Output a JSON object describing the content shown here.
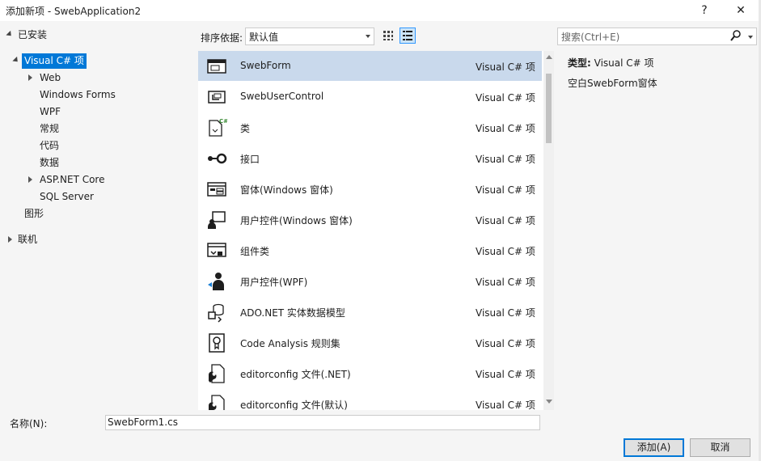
{
  "window": {
    "title": "添加新项 - SwebApplication2",
    "help_label": "?",
    "close_label": "✕"
  },
  "tree": {
    "installed": "已安装",
    "visual_cs": "Visual C# 项",
    "web": "Web",
    "winforms": "Windows Forms",
    "wpf": "WPF",
    "normal": "常规",
    "code": "代码",
    "data": "数据",
    "aspnet": "ASP.NET Core",
    "sql": "SQL Server",
    "graphics": "图形",
    "online": "联机"
  },
  "toolbar": {
    "sort_label": "排序依据:",
    "sort_value": "默认值",
    "search_placeholder": "搜索(Ctrl+E)"
  },
  "templates": [
    {
      "name": "SwebForm",
      "category": "Visual C# 项",
      "icon": "form-icon"
    },
    {
      "name": "SwebUserControl",
      "category": "Visual C# 项",
      "icon": "user-control-icon"
    },
    {
      "name": "类",
      "category": "Visual C# 项",
      "icon": "class-icon"
    },
    {
      "name": "接口",
      "category": "Visual C# 项",
      "icon": "interface-icon"
    },
    {
      "name": "窗体(Windows 窗体)",
      "category": "Visual C# 项",
      "icon": "window-form-icon"
    },
    {
      "name": "用户控件(Windows 窗体)",
      "category": "Visual C# 项",
      "icon": "user-control-winforms-icon"
    },
    {
      "name": "组件类",
      "category": "Visual C# 项",
      "icon": "component-class-icon"
    },
    {
      "name": "用户控件(WPF)",
      "category": "Visual C# 项",
      "icon": "user-control-wpf-icon"
    },
    {
      "name": "ADO.NET 实体数据模型",
      "category": "Visual C# 项",
      "icon": "entity-model-icon"
    },
    {
      "name": "Code Analysis 规则集",
      "category": "Visual C# 项",
      "icon": "ruleset-icon"
    },
    {
      "name": "editorconfig 文件(.NET)",
      "category": "Visual C# 项",
      "icon": "editorconfig-icon"
    },
    {
      "name": "editorconfig 文件(默认)",
      "category": "Visual C# 项",
      "icon": "editorconfig-icon"
    }
  ],
  "details": {
    "type_label": "类型:",
    "type_value": "Visual C# 项",
    "description": "空白SwebForm窗体"
  },
  "footer": {
    "name_label": "名称(N):",
    "name_value": "SwebForm1.cs",
    "add_label": "添加(A)",
    "cancel_label": "取消"
  },
  "colors": {
    "selection": "#0078d7",
    "row_selected": "#c9d9ec"
  }
}
